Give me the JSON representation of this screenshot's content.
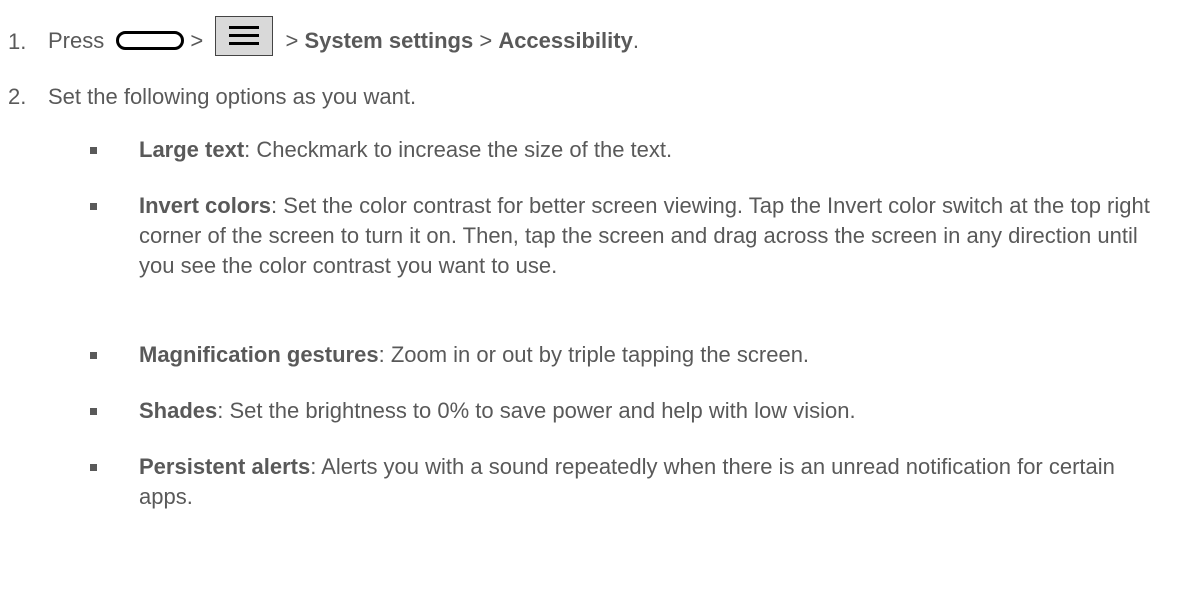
{
  "steps": [
    {
      "number": "1.",
      "prefix": "Press",
      "sep1": ">",
      "sep2": ">",
      "bold1": "System settings",
      "sep3": ">",
      "bold2": "Accessibility",
      "suffix": "."
    },
    {
      "number": "2.",
      "text": "Set the following options as you want."
    }
  ],
  "options": [
    {
      "term": "Large text",
      "desc": ": Checkmark to increase the size of the text."
    },
    {
      "term": "Invert colors",
      "desc": ": Set the color contrast for better screen viewing. Tap the Invert color switch at the top right corner of the screen to turn it on. Then, tap the screen and drag across the screen in any direction until you see the color contrast you want to use."
    },
    {
      "term": "Magnification gestures",
      "desc": ": Zoom in or out by triple tapping the screen."
    },
    {
      "term": "Shades",
      "desc": ": Set the brightness to 0% to save power and help with low vision."
    },
    {
      "term": "Persistent alerts",
      "desc": ": Alerts you with a sound repeatedly when there is an unread notification for certain apps."
    }
  ],
  "icons": {
    "home": "home-button-icon",
    "menu": "menu-button-icon"
  }
}
